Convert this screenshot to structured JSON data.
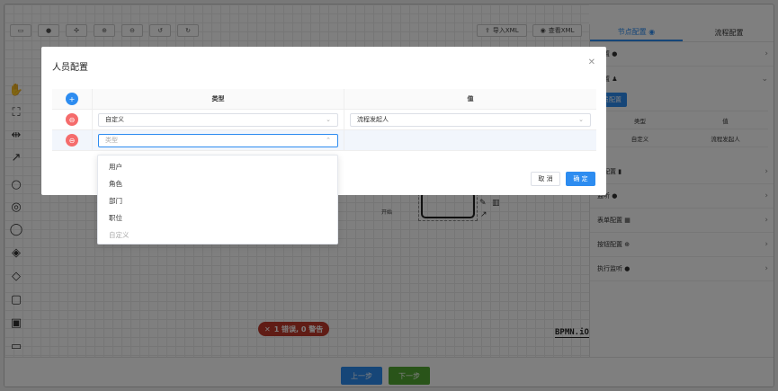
{
  "toolbar": {
    "icons": [
      "folder-icon",
      "download-icon",
      "fit-icon",
      "zoom-in-icon",
      "zoom-out-icon",
      "undo-icon",
      "redo-icon"
    ],
    "import_xml": "导入XML",
    "view_xml": "查看XML"
  },
  "canvas": {
    "start_label": "开始",
    "error_badge": "1 错误, 0 警告",
    "logo": "BPMN.iO"
  },
  "right_panel": {
    "tabs": [
      "节点配置",
      "流程配置"
    ],
    "rows": [
      {
        "label": "配置"
      },
      {
        "label": "配置"
      },
      {
        "label": "例配置"
      },
      {
        "label": "监听"
      },
      {
        "label": "表单配置"
      },
      {
        "label": "按钮配置"
      },
      {
        "label": "执行监听"
      }
    ],
    "user_config_btn": "员配置",
    "mini_table": {
      "headers": [
        "类型",
        "值"
      ],
      "row": [
        "自定义",
        "流程发起人"
      ]
    }
  },
  "footer": {
    "prev": "上一步",
    "next": "下一步"
  },
  "modal": {
    "title": "人员配置",
    "headers": {
      "type": "类型",
      "value": "值"
    },
    "rows": [
      {
        "type": "自定义",
        "value": "流程发起人"
      },
      {
        "type_placeholder": "类型",
        "value": ""
      }
    ],
    "cancel": "取 消",
    "confirm": "确 定"
  },
  "dropdown": {
    "options": [
      "用户",
      "角色",
      "部门",
      "职位",
      "自定义"
    ]
  },
  "colors": {
    "primary": "#2d8cf0",
    "danger": "#f56c6c",
    "error_badge": "#c0392b",
    "next_btn": "#52a833"
  }
}
